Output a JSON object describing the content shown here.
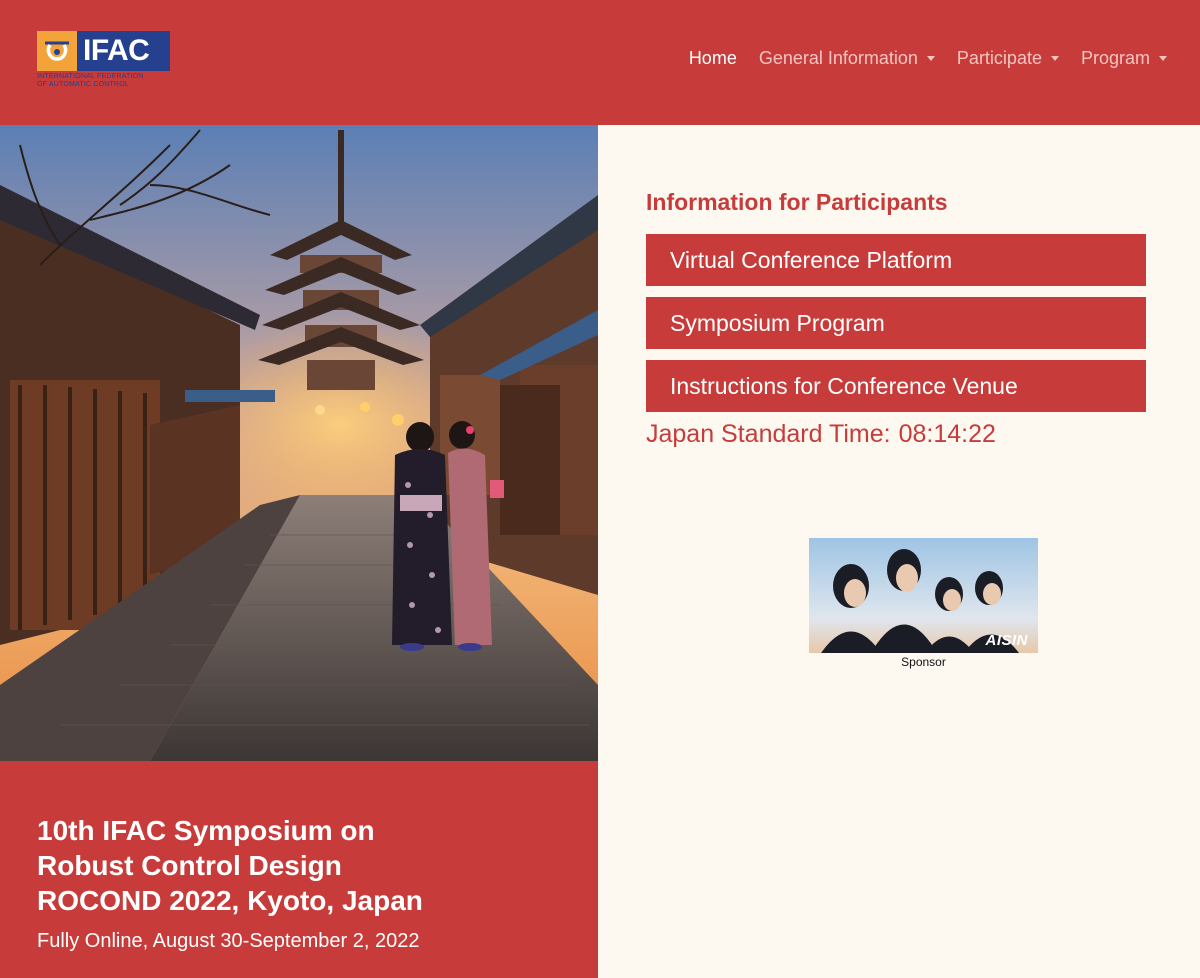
{
  "header": {
    "logo": {
      "word": "IFAC",
      "subtitle_line1": "INTERNATIONAL FEDERATION",
      "subtitle_line2": "OF AUTOMATIC CONTROL"
    },
    "nav": [
      {
        "label": "Home",
        "active": true,
        "dropdown": false
      },
      {
        "label": "General Information",
        "active": false,
        "dropdown": true
      },
      {
        "label": "Participate",
        "active": false,
        "dropdown": true
      },
      {
        "label": "Program",
        "active": false,
        "dropdown": true
      }
    ]
  },
  "info": {
    "title": "Information for Participants",
    "buttons": [
      {
        "label": "Virtual Conference Platform"
      },
      {
        "label": "Symposium Program"
      },
      {
        "label": "Instructions for Conference Venue"
      }
    ],
    "time_label": "Japan Standard Time:",
    "time_value": "08:14:22"
  },
  "sponsor": {
    "logo_text": "AISIN",
    "label": "Sponsor"
  },
  "conference": {
    "title_line1": "10th IFAC Symposium on",
    "title_line2": "Robust Control Design",
    "title_line3": "ROCOND 2022, Kyoto, Japan",
    "subtitle": "Fully Online, August 30-September 2, 2022"
  },
  "colors": {
    "brand_red": "#c73c3a",
    "page_background": "#fdf9f1",
    "ifac_blue": "#24408e",
    "ifac_orange": "#f2a43a"
  }
}
